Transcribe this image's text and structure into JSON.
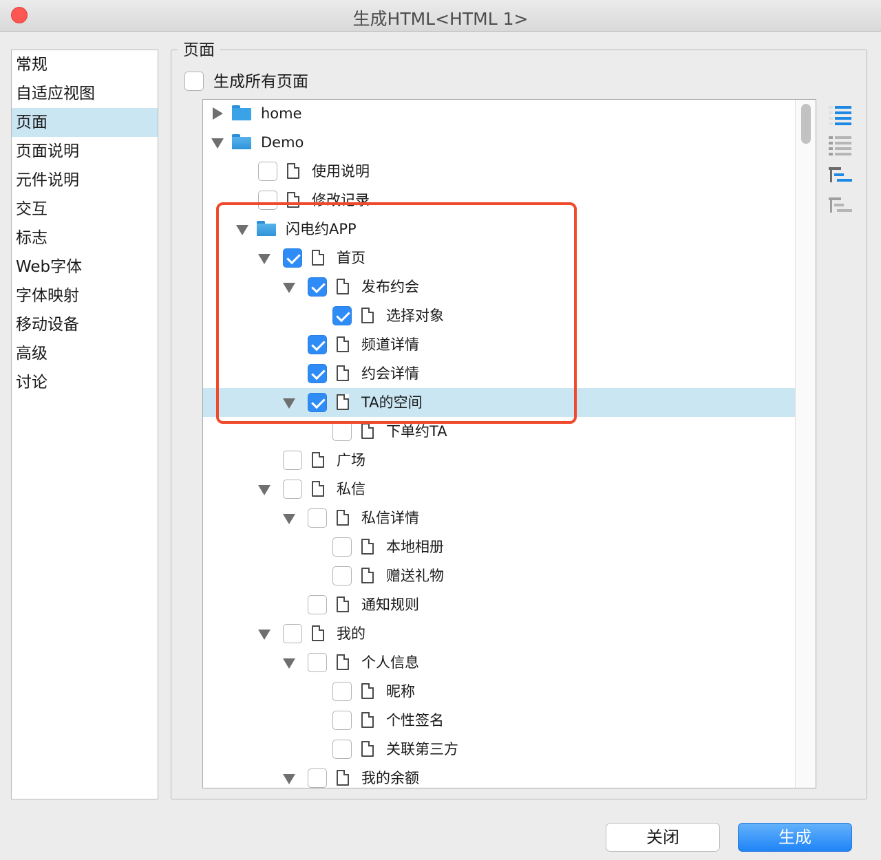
{
  "window": {
    "title": "生成HTML<HTML 1>"
  },
  "sidebar": {
    "items": [
      "常规",
      "自适应视图",
      "页面",
      "页面说明",
      "元件说明",
      "交互",
      "标志",
      "Web字体",
      "字体映射",
      "移动设备",
      "高级",
      "讨论"
    ],
    "selected_index": 2
  },
  "panel": {
    "legend": "页面",
    "generate_all_label": "生成所有页面",
    "generate_all_checked": false
  },
  "tree": {
    "rows": [
      {
        "label": "home",
        "depth": 0,
        "kind": "folder",
        "expander": "collapsed"
      },
      {
        "label": "Demo",
        "depth": 0,
        "kind": "folder",
        "expander": "expanded"
      },
      {
        "label": "使用说明",
        "depth": 1,
        "kind": "page",
        "checked": false
      },
      {
        "label": "修改记录",
        "depth": 1,
        "kind": "page",
        "checked": false
      },
      {
        "label": "闪电约APP",
        "depth": 1,
        "kind": "folder",
        "expander": "expanded"
      },
      {
        "label": "首页",
        "depth": 2,
        "kind": "page",
        "expander": "expanded",
        "checked": true
      },
      {
        "label": "发布约会",
        "depth": 3,
        "kind": "page",
        "expander": "expanded",
        "checked": true
      },
      {
        "label": "选择对象",
        "depth": 4,
        "kind": "page",
        "checked": true
      },
      {
        "label": "频道详情",
        "depth": 3,
        "kind": "page",
        "checked": true
      },
      {
        "label": "约会详情",
        "depth": 3,
        "kind": "page",
        "checked": true
      },
      {
        "label": "TA的空间",
        "depth": 3,
        "kind": "page",
        "expander": "expanded",
        "checked": true,
        "selected": true
      },
      {
        "label": "下单约TA",
        "depth": 4,
        "kind": "page",
        "checked": false
      },
      {
        "label": "广场",
        "depth": 2,
        "kind": "page",
        "checked": false
      },
      {
        "label": "私信",
        "depth": 2,
        "kind": "page",
        "expander": "expanded",
        "checked": false
      },
      {
        "label": "私信详情",
        "depth": 3,
        "kind": "page",
        "expander": "expanded",
        "checked": false
      },
      {
        "label": "本地相册",
        "depth": 4,
        "kind": "page",
        "checked": false
      },
      {
        "label": "赠送礼物",
        "depth": 4,
        "kind": "page",
        "checked": false
      },
      {
        "label": "通知规则",
        "depth": 3,
        "kind": "page",
        "checked": false
      },
      {
        "label": "我的",
        "depth": 2,
        "kind": "page",
        "expander": "expanded",
        "checked": false
      },
      {
        "label": "个人信息",
        "depth": 3,
        "kind": "page",
        "expander": "expanded",
        "checked": false
      },
      {
        "label": "昵称",
        "depth": 4,
        "kind": "page",
        "checked": false
      },
      {
        "label": "个性签名",
        "depth": 4,
        "kind": "page",
        "checked": false
      },
      {
        "label": "关联第三方",
        "depth": 4,
        "kind": "page",
        "checked": false
      },
      {
        "label": "我的余额",
        "depth": 3,
        "kind": "page",
        "expander": "expanded",
        "checked": false
      }
    ]
  },
  "toolbar": {
    "icons": [
      "check-all-icon",
      "uncheck-all-icon",
      "check-children-icon",
      "uncheck-children-icon"
    ]
  },
  "buttons": {
    "close": "关闭",
    "generate": "生成"
  },
  "colors": {
    "accent": "#2f8cf7",
    "selection": "#cbe6f3",
    "annotation": "#f04a2c"
  }
}
